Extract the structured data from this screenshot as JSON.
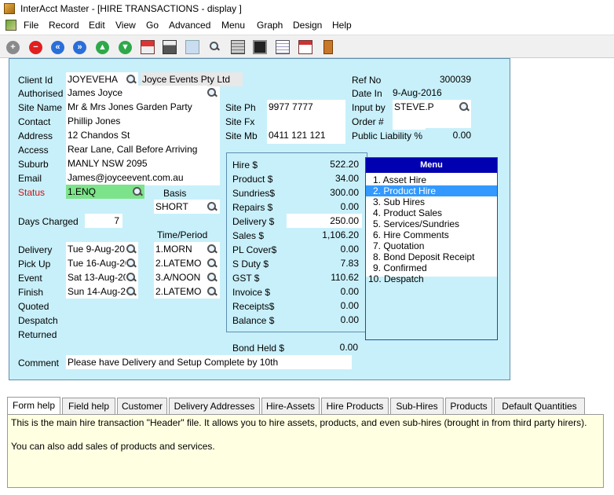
{
  "window": {
    "title": "InterAcct Master - [HIRE TRANSACTIONS - display ]"
  },
  "menubar": [
    "File",
    "Record",
    "Edit",
    "View",
    "Go",
    "Advanced",
    "Menu",
    "Graph",
    "Design",
    "Help"
  ],
  "toolbar": [
    "plus-icon",
    "stop-icon",
    "first-record-icon",
    "last-record-icon",
    "previous-record-icon",
    "next-record-icon",
    "home-icon",
    "print-icon",
    "pointer-icon",
    "search-icon",
    "calculator-icon",
    "monitor-icon",
    "notepad-icon",
    "calendar-icon",
    "exit-door-icon"
  ],
  "form": {
    "client_id_label": "Client Id",
    "client_id": "JOYEVEHA",
    "client_name": "Joyce Events Pty Ltd",
    "authorised_label": "Authorised",
    "authorised": "James Joyce",
    "site_name_label": "Site Name",
    "site_name": "Mr & Mrs Jones Garden Party",
    "contact_label": "Contact",
    "contact": "Phillip Jones",
    "address_label": "Address",
    "address": "12 Chandos St",
    "access_label": "Access",
    "access": "Rear Lane, Call Before Arriving",
    "suburb_label": "Suburb",
    "suburb": "MANLY NSW 2095",
    "email_label": "Email",
    "email": "James@joyceevent.com.au",
    "status_label": "Status",
    "status": "1.ENQ",
    "basis_label": "Basis",
    "basis": "SHORT",
    "site_ph_label": "Site Ph",
    "site_ph": "9977 7777",
    "site_fx_label": "Site Fx",
    "site_fx": "",
    "site_mb_label": "Site Mb",
    "site_mb": "0411 121 121",
    "ref_no_label": "Ref No",
    "ref_no": "300039",
    "date_in_label": "Date In",
    "date_in": "9-Aug-2016",
    "input_by_label": "Input by",
    "input_by": "STEVE.P",
    "order_label": "Order #",
    "order": "",
    "public_liability_label": "Public Liability %",
    "public_liability": "0.00",
    "days_charged_label": "Days Charged",
    "days_charged": "7",
    "time_period_label": "Time/Period",
    "delivery_label": "Delivery",
    "delivery_date": "Tue 9-Aug-201",
    "delivery_time": "1.MORN",
    "pickup_label": "Pick Up",
    "pickup_date": "Tue 16-Aug-20",
    "pickup_time": "2.LATEMO",
    "event_label": "Event",
    "event_date": "Sat 13-Aug-20",
    "event_time": "3.A/NOON",
    "finish_label": "Finish",
    "finish_date": "Sun 14-Aug-20",
    "finish_time": "2.LATEMO",
    "quoted_label": "Quoted",
    "despatch_label": "Despatch",
    "returned_label": "Returned",
    "bond_held_label": "Bond Held $",
    "bond_held": "0.00",
    "comment_label": "Comment",
    "comment": "Please have Delivery and Setup Complete by 10th"
  },
  "financials": [
    {
      "label": "Hire   $",
      "value": "522.20"
    },
    {
      "label": "Product $",
      "value": "34.00"
    },
    {
      "label": "Sundries$",
      "value": "300.00"
    },
    {
      "label": "Repairs $",
      "value": "0.00"
    },
    {
      "label": "Delivery $",
      "value": "250.00"
    },
    {
      "label": "Sales   $",
      "value": "1,106.20"
    },
    {
      "label": "PL Cover$",
      "value": "0.00"
    },
    {
      "label": "S Duty  $",
      "value": "7.83"
    },
    {
      "label": "GST    $",
      "value": "110.62"
    },
    {
      "label": "Invoice $",
      "value": "0.00"
    },
    {
      "label": "Receipts$",
      "value": "0.00"
    },
    {
      "label": "Balance $",
      "value": "0.00"
    }
  ],
  "menu": {
    "title": "Menu",
    "items": [
      "1. Asset Hire",
      "2. Product Hire",
      "3. Sub Hires",
      "4. Product Sales",
      "5. Services/Sundries",
      "6. Hire Comments",
      "7. Quotation",
      "8. Bond Deposit Receipt",
      "9. Confirmed",
      "10. Despatch"
    ],
    "selected_index": 1
  },
  "tabs": [
    "Form help",
    "Field help",
    "Customer",
    "Delivery Addresses",
    "Hire-Assets",
    "Hire Products",
    "Sub-Hires",
    "Products",
    "Default Quantities"
  ],
  "help": {
    "line1": "This is the main hire transaction \"Header\" file.  It allows you to hire assets, products, and even sub-hires (brought in from third party hirers).",
    "line2": "You can also add sales of products and services."
  },
  "colors": {
    "panel": "#c8f0fa",
    "status_field": "#7de38a",
    "menu_header": "#0000b0",
    "menu_selected": "#3399ff",
    "help_bg": "#ffffe1"
  }
}
